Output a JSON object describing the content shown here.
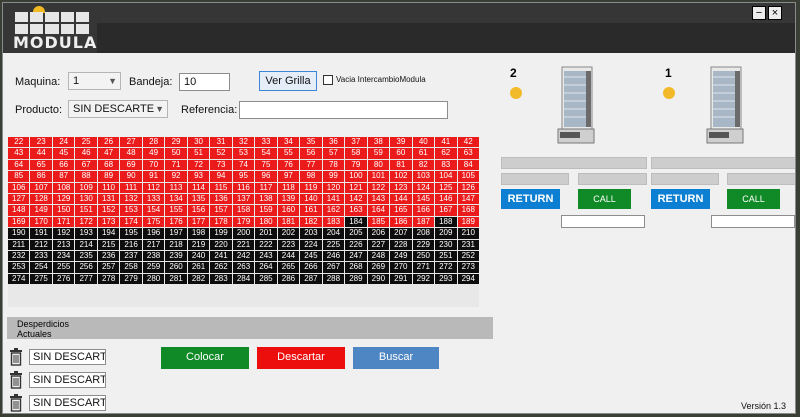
{
  "app": {
    "logo_text": "MODULA",
    "version": "Versión 1.3"
  },
  "window_controls": {
    "minimize_glyph": "−",
    "close_glyph": "×"
  },
  "form": {
    "maquina_label": "Maquina:",
    "maquina_value": "1",
    "bandeja_label": "Bandeja:",
    "bandeja_value": "10",
    "ver_grilla_label": "Ver Grilla",
    "vacia_label": "Vacia IntercambioModula",
    "vacia_checked": false,
    "producto_label": "Producto:",
    "producto_value": "SIN DESCARTE",
    "referencia_label": "Referencia:",
    "referencia_value": ""
  },
  "grid": {
    "start": 22,
    "end": 294,
    "columns": 21,
    "black_from": 190,
    "highlight_black": [
      184,
      188
    ],
    "colors": {
      "occupied": "#ec1b1b",
      "free": "#0d0d0d"
    }
  },
  "desperdicios": {
    "header_line1": "Desperdicios",
    "header_line2": "Actuales",
    "items": [
      "SIN DESCARTE",
      "SIN DESCARTE",
      "SIN DESCARTE"
    ]
  },
  "actions": {
    "colocar": "Colocar",
    "descartar": "Descartar",
    "buscar": "Buscar",
    "colors": {
      "colocar": "#108a26",
      "descartar": "#ec0d0d",
      "buscar": "#4e86c3"
    }
  },
  "machines": [
    {
      "number": "2",
      "return_label": "RETURN",
      "call_label": "CALL"
    },
    {
      "number": "1",
      "return_label": "RETURN",
      "call_label": "CALL"
    }
  ]
}
